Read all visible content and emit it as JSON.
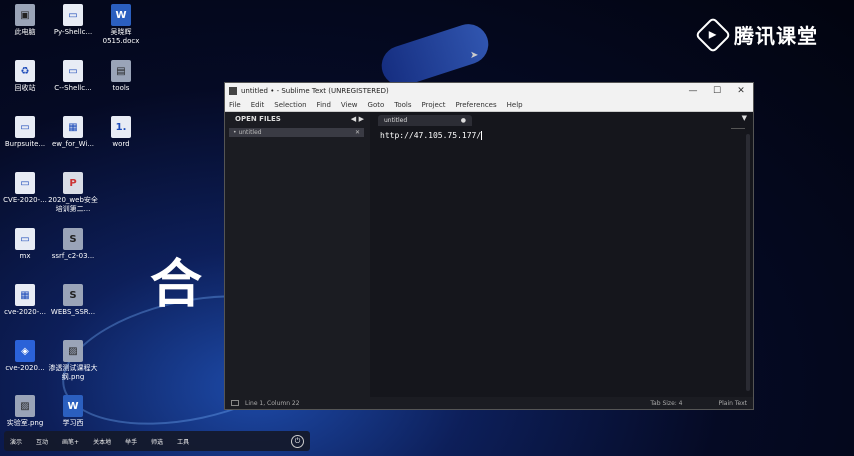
{
  "brand": {
    "logo_glyph": "▶",
    "text": "腾讯课堂"
  },
  "big_char": "合",
  "desktop": {
    "icons": [
      {
        "label": "此电脑",
        "glyph": "▣",
        "style": "dark"
      },
      {
        "label": "Py-Shellc...",
        "glyph": "▭",
        "style": ""
      },
      {
        "label": "吴晓辉0515.docx",
        "glyph": "W",
        "style": "word"
      },
      {
        "label": "回收站",
        "glyph": "♻",
        "style": ""
      },
      {
        "label": "C--Shellc...",
        "glyph": "▭",
        "style": ""
      },
      {
        "label": "tools",
        "glyph": "▤",
        "style": "dark"
      },
      {
        "label": "Burpsuite...",
        "glyph": "▭",
        "style": ""
      },
      {
        "label": "ew_for_Wi...",
        "glyph": "▦",
        "style": ""
      },
      {
        "label": "word",
        "glyph": "1.",
        "style": ""
      },
      {
        "label": "CVE-2020-...",
        "glyph": "▭",
        "style": ""
      },
      {
        "label": "2020_web安全培训第二...",
        "glyph": "P",
        "style": "ppt"
      },
      {
        "label": "mx",
        "glyph": "▭",
        "style": ""
      },
      {
        "label": "ssrf_c2-03...",
        "glyph": "S",
        "style": "dark"
      },
      {
        "label": "cve-2020-...",
        "glyph": "▦",
        "style": ""
      },
      {
        "label": "WEBS_SSR...",
        "glyph": "S",
        "style": "dark"
      },
      {
        "label": "cve-2020...",
        "glyph": "◈",
        "style": "blue"
      },
      {
        "label": "渗透测试课程大纲.png",
        "glyph": "▨",
        "style": "dark"
      },
      {
        "label": "实验室.png",
        "glyph": "▨",
        "style": "dark"
      },
      {
        "label": "学习西",
        "glyph": "W",
        "style": "word"
      }
    ]
  },
  "window": {
    "title": "untitled • - Sublime Text (UNREGISTERED)",
    "controls": [
      "—",
      "☐",
      "✕"
    ],
    "menu": [
      "File",
      "Edit",
      "Selection",
      "Find",
      "View",
      "Goto",
      "Tools",
      "Project",
      "Preferences",
      "Help"
    ],
    "sidebar": {
      "header": "OPEN FILES",
      "nav": "◀ ▶",
      "files": [
        {
          "name": "• untitled",
          "close": "✕"
        }
      ]
    },
    "tab": {
      "label": "untitled",
      "dirty": "●"
    },
    "tab_menu": "▼",
    "code_line": "http://47.105.75.177/",
    "status": {
      "position": "Line 1, Column 22",
      "tab_size": "Tab Size: 4",
      "syntax": "Plain Text"
    }
  },
  "taskbar": {
    "items": [
      "演示",
      "互动",
      "画笔+",
      "关本地",
      "举手",
      "师选",
      "工具"
    ],
    "power": "⏻"
  },
  "mouse_cursor": "➤"
}
